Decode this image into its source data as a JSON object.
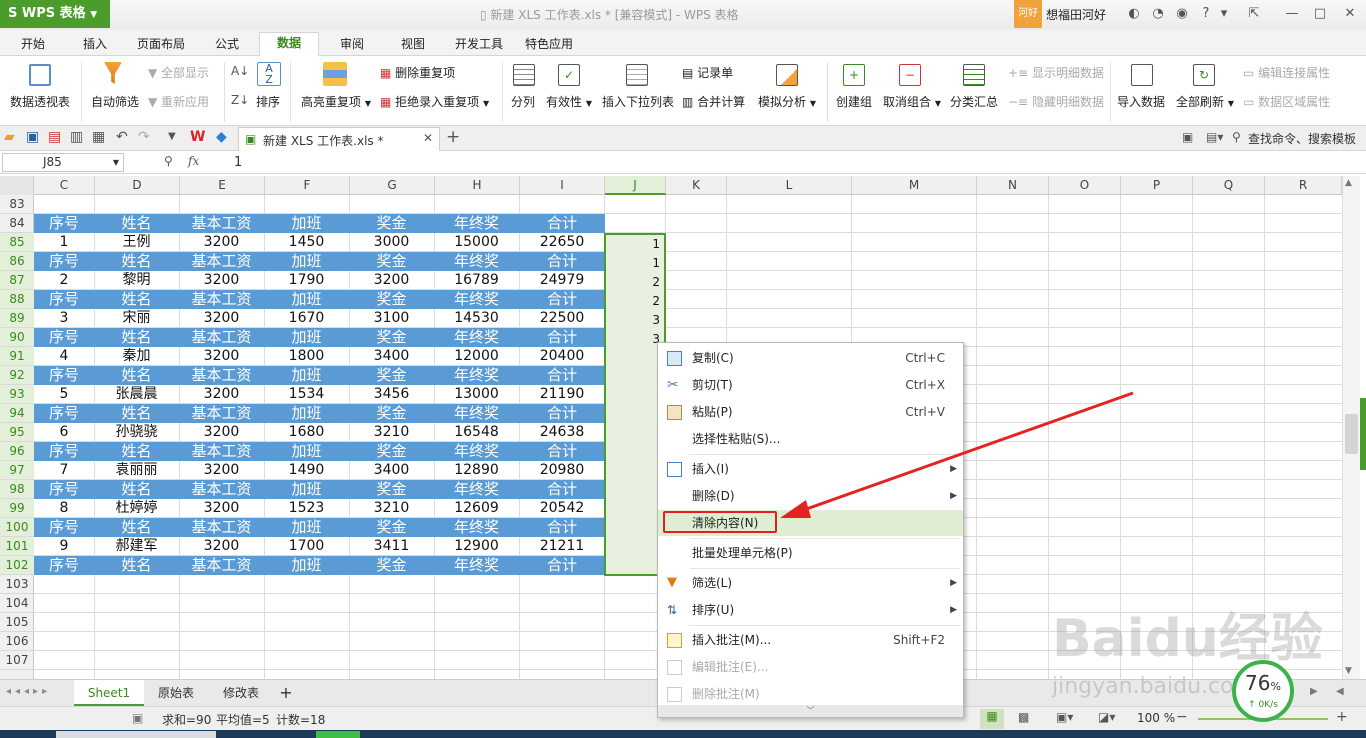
{
  "app": {
    "name": "WPS 表格",
    "doc_title": "新建 XLS 工作表.xls * [兼容模式] - WPS 表格",
    "user_tag": "河好",
    "user_name": "想福田河好"
  },
  "tabs": [
    "开始",
    "插入",
    "页面布局",
    "公式",
    "数据",
    "审阅",
    "视图",
    "开发工具",
    "特色应用"
  ],
  "ribbon": {
    "pivot": "数据透视表",
    "autofilter": "自动筛选",
    "show_all": "全部显示",
    "reapply": "重新应用",
    "sort": "排序",
    "highlight_dup": "高亮重复项",
    "remove_dup": "删除重复项",
    "reject_dup": "拒绝录入重复项",
    "split": "分列",
    "validity": "有效性",
    "dropdown": "插入下拉列表",
    "record": "记录单",
    "merge_calc": "合并计算",
    "simulate": "模拟分析",
    "group": "创建组",
    "ungroup": "取消组合",
    "subtotal": "分类汇总",
    "show_detail": "显示明细数据",
    "hide_detail": "隐藏明细数据",
    "import": "导入数据",
    "refresh_all": "全部刷新",
    "edit_conn": "编辑连接属性",
    "range_prop": "数据区域属性"
  },
  "quickbar": {
    "doc_tab": "新建 XLS 工作表.xls *",
    "search": "查找命令、搜索模板"
  },
  "formula": {
    "cell_ref": "J85",
    "fx": "fx",
    "value": "1"
  },
  "columns": [
    "C",
    "D",
    "E",
    "F",
    "G",
    "H",
    "I",
    "J",
    "K",
    "L",
    "M",
    "N",
    "O",
    "P",
    "Q",
    "R"
  ],
  "rows": [
    "83",
    "84",
    "85",
    "86",
    "87",
    "88",
    "89",
    "90",
    "91",
    "92",
    "93",
    "94",
    "95",
    "96",
    "97",
    "98",
    "99",
    "100",
    "101",
    "102",
    "103",
    "104",
    "105",
    "106",
    "107"
  ],
  "header_row": [
    "序号",
    "姓名",
    "基本工资",
    "加班",
    "奖金",
    "年终奖",
    "合计"
  ],
  "records": [
    [
      "1",
      "王例",
      "3200",
      "1450",
      "3000",
      "15000",
      "22650"
    ],
    [
      "2",
      "黎明",
      "3200",
      "1790",
      "3200",
      "16789",
      "24979"
    ],
    [
      "3",
      "宋丽",
      "3200",
      "1670",
      "3100",
      "14530",
      "22500"
    ],
    [
      "4",
      "秦加",
      "3200",
      "1800",
      "3400",
      "12000",
      "20400"
    ],
    [
      "5",
      "张晨晨",
      "3200",
      "1534",
      "3456",
      "13000",
      "21190"
    ],
    [
      "6",
      "孙骁骁",
      "3200",
      "1680",
      "3210",
      "16548",
      "24638"
    ],
    [
      "7",
      "袁丽丽",
      "3200",
      "1490",
      "3400",
      "12890",
      "20980"
    ],
    [
      "8",
      "杜婷婷",
      "3200",
      "1523",
      "3210",
      "12609",
      "20542"
    ],
    [
      "9",
      "郝建军",
      "3200",
      "1700",
      "3411",
      "12900",
      "21211"
    ]
  ],
  "j_values": [
    "1",
    "1",
    "2",
    "2",
    "3",
    "3"
  ],
  "context_menu": {
    "copy": "复制(C)",
    "copy_sc": "Ctrl+C",
    "cut": "剪切(T)",
    "cut_sc": "Ctrl+X",
    "paste": "粘贴(P)",
    "paste_sc": "Ctrl+V",
    "paste_special": "选择性粘贴(S)...",
    "insert": "插入(I)",
    "delete": "删除(D)",
    "clear": "清除内容(N)",
    "batch": "批量处理单元格(P)",
    "filter": "筛选(L)",
    "sort": "排序(U)",
    "insert_comment": "插入批注(M)...",
    "insert_comment_sc": "Shift+F2",
    "edit_comment": "编辑批注(E)...",
    "delete_comment": "删除批注(M)"
  },
  "sheets": [
    "Sheet1",
    "原始表",
    "修改表"
  ],
  "status": {
    "sum": "求和=90",
    "avg": "平均值=5",
    "count": "计数=18",
    "zoom": "100 %"
  },
  "speed": {
    "percent": "76",
    "unit": "%",
    "rate": "0K/s"
  },
  "watermark": {
    "brand": "Baidu经验",
    "url": "jingyan.baidu.com"
  }
}
